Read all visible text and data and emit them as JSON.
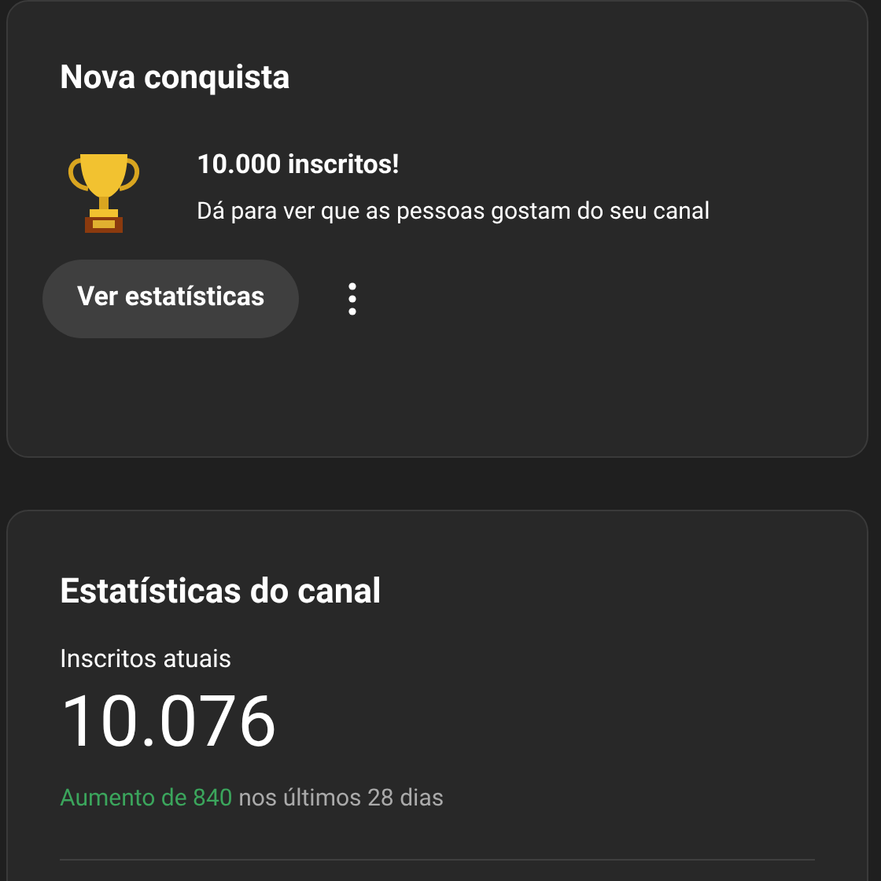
{
  "achievement_card": {
    "title": "Nova conquista",
    "headline": "10.000 inscritos!",
    "description": "Dá para ver que as pessoas gostam do seu canal",
    "button": "Ver estatísticas"
  },
  "stats_card": {
    "title": "Estatísticas do canal",
    "label": "Inscritos atuais",
    "value": "10.076",
    "increase": "Aumento de 840",
    "period": "nos últimos 28 dias"
  }
}
